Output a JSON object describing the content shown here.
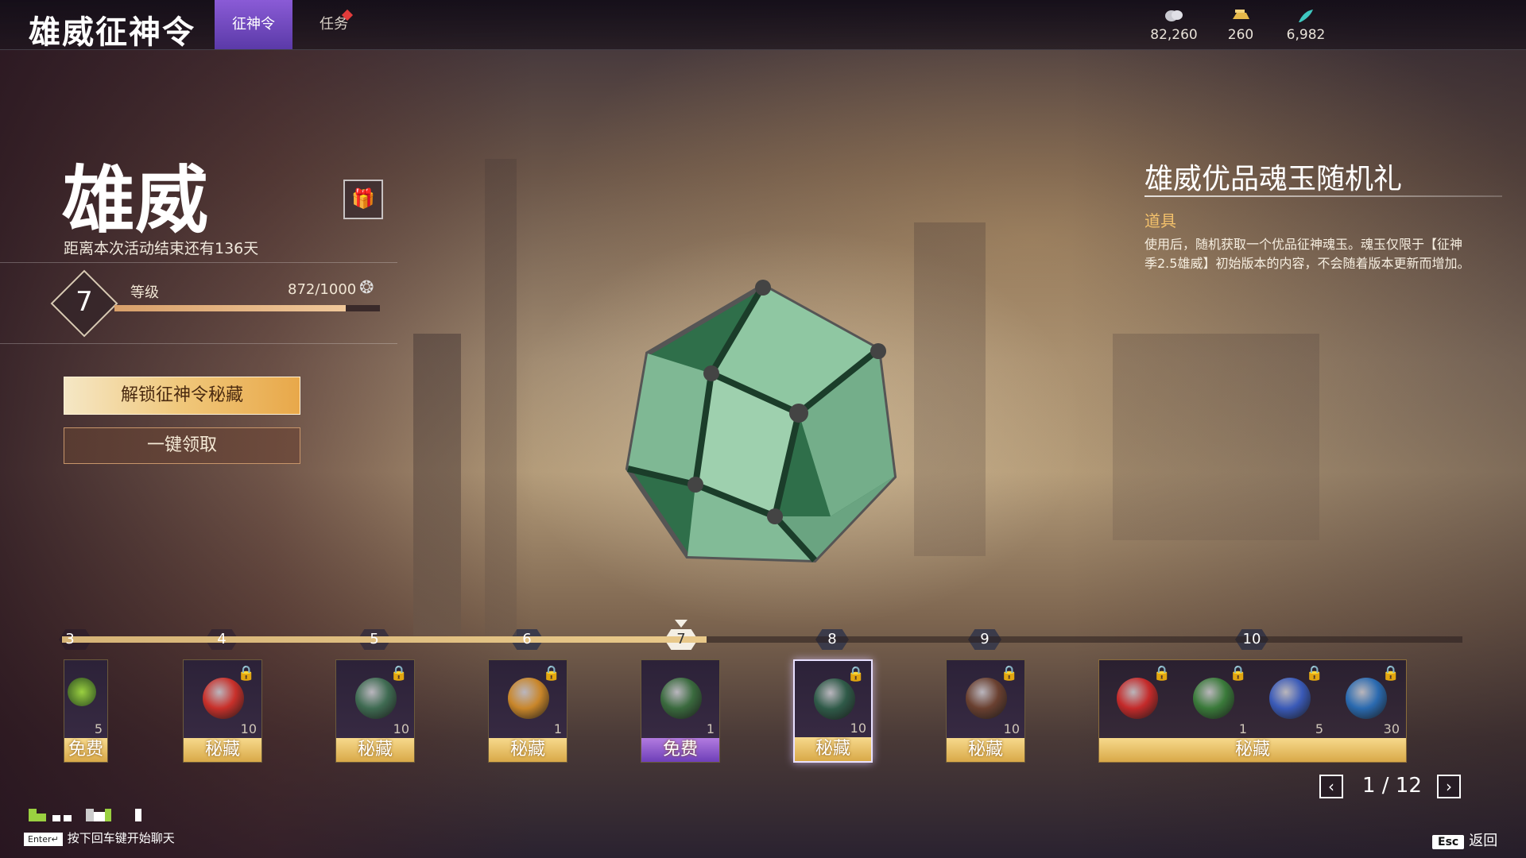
{
  "header": {
    "app_title": "雄威征神令",
    "tabs": [
      {
        "label": "征神令",
        "active": true
      },
      {
        "label": "任务",
        "active": false,
        "badge": "red-dot"
      }
    ],
    "currencies": [
      {
        "icon": "coin-icon",
        "value": "82,260"
      },
      {
        "icon": "gold-ingot-icon",
        "value": "260"
      },
      {
        "icon": "feather-icon",
        "value": "6,982"
      }
    ]
  },
  "season": {
    "title": "雄威",
    "countdown": "距离本次活动结束还有136天",
    "level": "7",
    "level_label": "等级",
    "xp_text": "872/1000",
    "xp_progress": 0.872
  },
  "actions": {
    "unlock_label": "解锁征神令秘藏",
    "claim_all_label": "一键领取"
  },
  "item": {
    "name": "雄威优品魂玉随机礼",
    "type": "道具",
    "description": "使用后，随机获取一个优品征神魂玉。魂玉仅限于【征神季2.5雄威】初始版本的内容，不会随着版本更新而增加。"
  },
  "track": {
    "current_level": "7",
    "filled_fraction": 0.46,
    "nodes": [
      "3",
      "4",
      "5",
      "6",
      "7",
      "8",
      "9",
      "10"
    ]
  },
  "rewards": [
    {
      "level": "3",
      "caption": "免费",
      "qty": "5",
      "locked": false,
      "partial": true
    },
    {
      "level": "4",
      "caption": "秘藏",
      "qty": "10",
      "locked": true,
      "orb": "#c8302a"
    },
    {
      "level": "5",
      "caption": "秘藏",
      "qty": "10",
      "locked": true,
      "orb": "#3f6b52"
    },
    {
      "level": "6",
      "caption": "秘藏",
      "qty": "1",
      "locked": true,
      "orb": "#c9862a"
    },
    {
      "level": "7",
      "caption": "免费",
      "qty": "1",
      "locked": false,
      "orb": "#3a6a3e",
      "free": true
    },
    {
      "level": "8",
      "caption": "秘藏",
      "qty": "10",
      "locked": true,
      "orb": "#2f5a48",
      "selected": true
    },
    {
      "level": "9",
      "caption": "秘藏",
      "qty": "10",
      "locked": true,
      "orb": "#6a4030"
    },
    {
      "level": "10",
      "caption": "秘藏",
      "sub_items": [
        {
          "qty": "",
          "orb": "#c42a2a"
        },
        {
          "qty": "1",
          "orb": "#3a7a3a"
        },
        {
          "qty": "5",
          "orb": "#3a5ab8"
        },
        {
          "qty": "30",
          "orb": "#2a6ab0"
        }
      ]
    }
  ],
  "pager": {
    "text": "1 / 12",
    "prev": "‹",
    "next": "›"
  },
  "footer": {
    "enter_key": "Enter↵",
    "chat_hint": "按下回车键开始聊天",
    "esc_key": "Esc",
    "back_label": "返回"
  },
  "colors": {
    "accent": "#7a4fd0",
    "gold": "#e9c98a",
    "free": "#8e5ad6"
  }
}
